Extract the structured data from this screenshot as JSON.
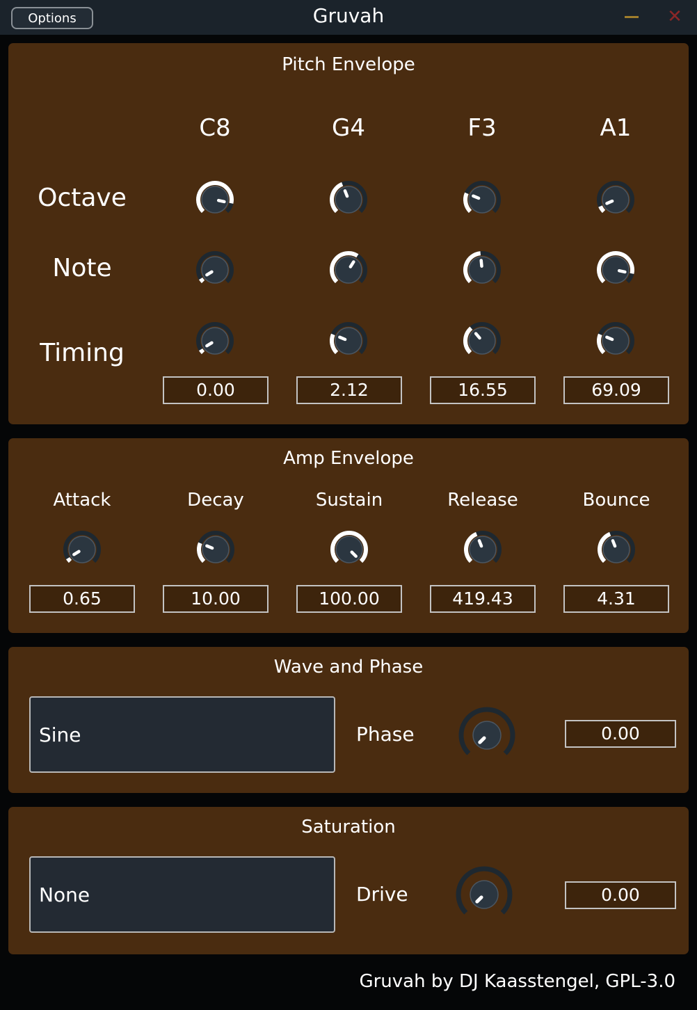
{
  "window": {
    "title": "Gruvah",
    "options_label": "Options",
    "close_glyph": "✕"
  },
  "pitch_envelope": {
    "title": "Pitch Envelope",
    "columns": [
      "C8",
      "G4",
      "F3",
      "A1"
    ],
    "rows": [
      "Octave",
      "Note",
      "Timing"
    ],
    "knob_levels": {
      "octave": [
        0.88,
        0.42,
        0.25,
        0.08
      ],
      "note": [
        0.05,
        0.62,
        0.48,
        0.88
      ],
      "timing": [
        0.05,
        0.25,
        0.35,
        0.25
      ]
    },
    "timing_values": [
      "0.00",
      "2.12",
      "16.55",
      "69.09"
    ]
  },
  "amp_envelope": {
    "title": "Amp Envelope",
    "params": [
      {
        "label": "Attack",
        "value": "0.65",
        "level": 0.05
      },
      {
        "label": "Decay",
        "value": "10.00",
        "level": 0.25
      },
      {
        "label": "Sustain",
        "value": "100.00",
        "level": 1.0
      },
      {
        "label": "Release",
        "value": "419.43",
        "level": 0.42
      },
      {
        "label": "Bounce",
        "value": "4.31",
        "level": 0.42
      }
    ]
  },
  "wave_and_phase": {
    "title": "Wave and Phase",
    "wave_selected": "Sine",
    "phase_label": "Phase",
    "phase_value": "0.00",
    "phase_level": 0.0
  },
  "saturation": {
    "title": "Saturation",
    "type_selected": "None",
    "drive_label": "Drive",
    "drive_value": "0.00",
    "drive_level": 0.0
  },
  "footer": {
    "credit": "Gruvah by DJ Kaasstengel, GPL-3.0"
  },
  "colors": {
    "panel": "#4a2c10",
    "titlebar": "#1b232b",
    "knob_body": "#2b3640",
    "knob_track": "#1e2830",
    "knob_fill": "#ffffff",
    "minimize": "#a07e2c",
    "close": "#8b2727"
  }
}
